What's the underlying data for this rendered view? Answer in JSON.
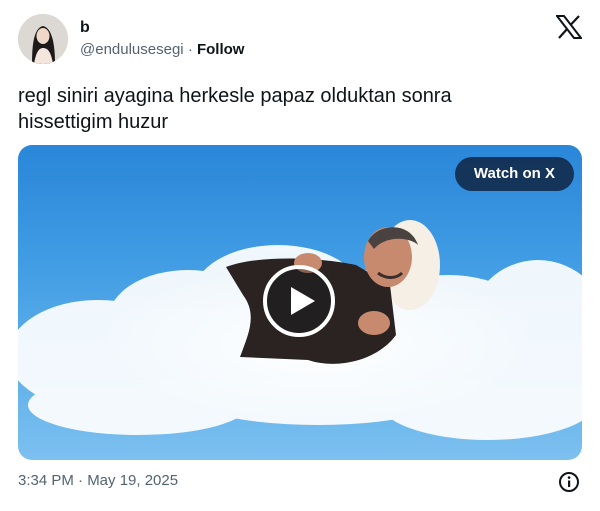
{
  "author": {
    "name": "b",
    "handle": "@endulusesegi",
    "separator": "·",
    "follow_label": "Follow"
  },
  "tweet": {
    "text_line1": "regl siniri ayagina herkesle papaz olduktan sonra",
    "text_line2": "hissettigim huzur"
  },
  "media": {
    "watch_label": "Watch on X"
  },
  "footer": {
    "timestamp": "3:34 PM · May 19, 2025"
  },
  "icons": {
    "logo": "x-logo-icon",
    "play": "play-icon",
    "info": "info-icon"
  },
  "colors": {
    "text": "#0f1419",
    "secondary": "#536471",
    "sky": "#3f9be3",
    "watch_bg": "#0f2542"
  }
}
